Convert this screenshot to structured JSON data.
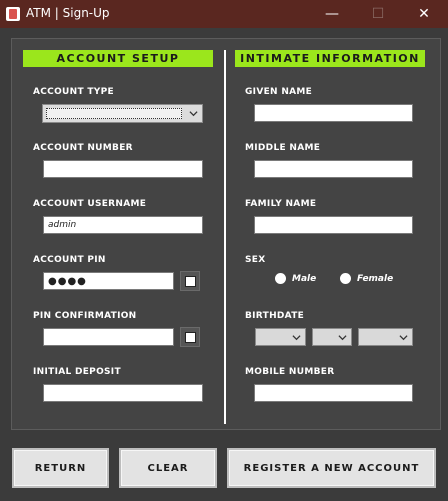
{
  "window": {
    "title": "ATM | Sign-Up",
    "controls": {
      "minimize": "—",
      "maximize": "☐",
      "close": "✕"
    },
    "colors": {
      "titlebar": "#5a2720",
      "background": "#3b3b3b",
      "accent": "#9be61c"
    }
  },
  "account_setup": {
    "header": "ACCOUNT SETUP",
    "account_type": {
      "label": "ACCOUNT TYPE",
      "value": ""
    },
    "account_number": {
      "label": "ACCOUNT NUMBER",
      "value": ""
    },
    "account_username": {
      "label": "ACCOUNT USERNAME",
      "value": "admin"
    },
    "account_pin": {
      "label": "ACCOUNT PIN",
      "value": "●●●●"
    },
    "pin_confirmation": {
      "label": "PIN CONFIRMATION",
      "value": ""
    },
    "initial_deposit": {
      "label": "INITIAL DEPOSIT",
      "value": ""
    }
  },
  "intimate_information": {
    "header": "INTIMATE INFORMATION",
    "given_name": {
      "label": "GIVEN NAME",
      "value": ""
    },
    "middle_name": {
      "label": "MIDDLE NAME",
      "value": ""
    },
    "family_name": {
      "label": "FAMILY NAME",
      "value": ""
    },
    "sex": {
      "label": "SEX",
      "options": [
        "Male",
        "Female"
      ]
    },
    "birthdate": {
      "label": "BIRTHDATE"
    },
    "mobile_number": {
      "label": "MOBILE NUMBER",
      "value": ""
    }
  },
  "actions": {
    "return": "RETURN",
    "clear": "CLEAR",
    "register": "REGISTER A NEW ACCOUNT"
  }
}
